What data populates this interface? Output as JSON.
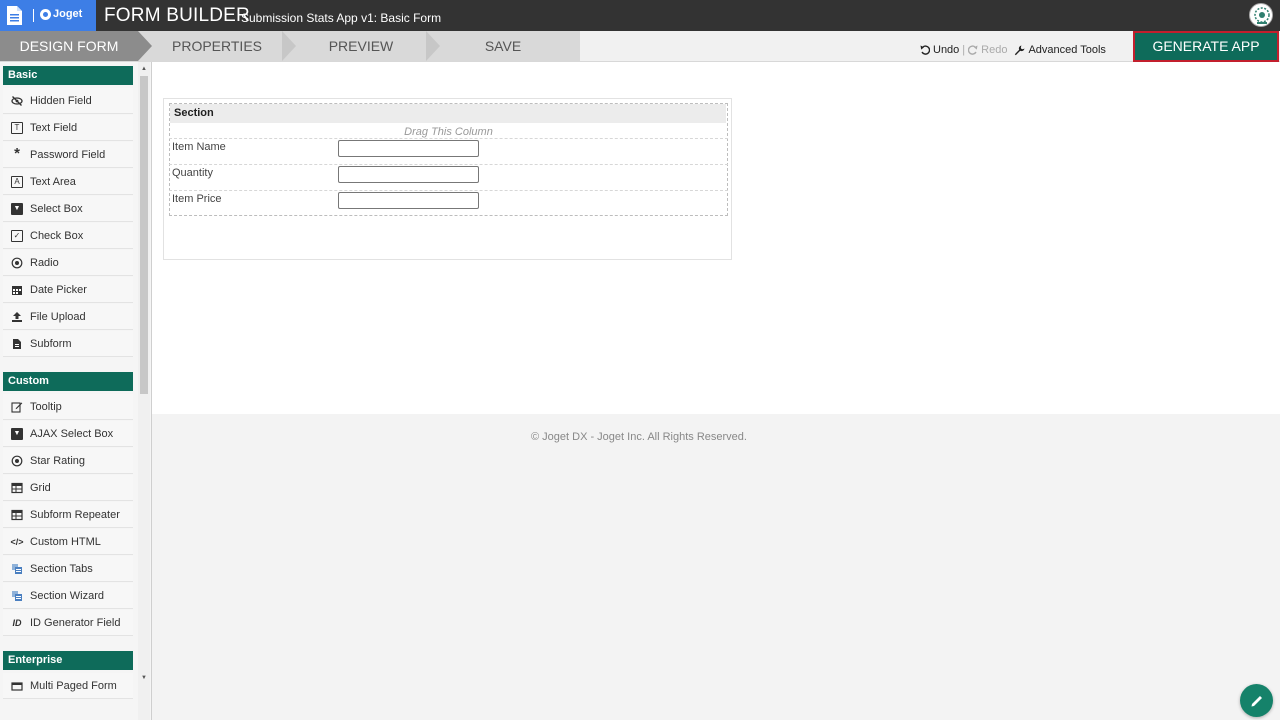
{
  "header": {
    "logo_text": "Joget",
    "title": "FORM BUILDER",
    "subtitle": "Submission Stats App v1: Basic Form"
  },
  "steps": [
    {
      "label": "DESIGN FORM",
      "active": true
    },
    {
      "label": "PROPERTIES",
      "active": false
    },
    {
      "label": "PREVIEW",
      "active": false
    },
    {
      "label": "SAVE",
      "active": false
    }
  ],
  "toolbar": {
    "undo": "Undo",
    "separator": "|",
    "redo": "Redo",
    "advanced_tools": "Advanced Tools",
    "generate_app": "GENERATE APP"
  },
  "palette": {
    "categories": [
      {
        "name": "Basic",
        "items": [
          {
            "label": "Hidden Field",
            "icon": "eye-slash-icon"
          },
          {
            "label": "Text Field",
            "icon": "text-field-icon"
          },
          {
            "label": "Password Field",
            "icon": "asterisk-icon"
          },
          {
            "label": "Text Area",
            "icon": "text-area-icon"
          },
          {
            "label": "Select Box",
            "icon": "caret-box-icon"
          },
          {
            "label": "Check Box",
            "icon": "checkbox-icon"
          },
          {
            "label": "Radio",
            "icon": "radio-icon"
          },
          {
            "label": "Date Picker",
            "icon": "calendar-icon"
          },
          {
            "label": "File Upload",
            "icon": "upload-icon"
          },
          {
            "label": "Subform",
            "icon": "file-icon"
          }
        ]
      },
      {
        "name": "Custom",
        "items": [
          {
            "label": "Tooltip",
            "icon": "edit-icon"
          },
          {
            "label": "AJAX Select Box",
            "icon": "caret-box-icon"
          },
          {
            "label": "Star Rating",
            "icon": "radio-icon"
          },
          {
            "label": "Grid",
            "icon": "table-icon"
          },
          {
            "label": "Subform Repeater",
            "icon": "table-icon"
          },
          {
            "label": "Custom HTML",
            "icon": "code-icon"
          },
          {
            "label": "Section Tabs",
            "icon": "section-icon"
          },
          {
            "label": "Section Wizard",
            "icon": "section-icon"
          },
          {
            "label": "ID Generator Field",
            "icon": "id-icon"
          }
        ]
      },
      {
        "name": "Enterprise",
        "items": [
          {
            "label": "Multi Paged Form",
            "icon": "pages-icon"
          }
        ]
      }
    ]
  },
  "form": {
    "section_title": "Section",
    "drag_column": "Drag This Column",
    "fields": [
      {
        "label": "Item Name",
        "value": ""
      },
      {
        "label": "Quantity",
        "value": ""
      },
      {
        "label": "Item Price",
        "value": ""
      }
    ]
  },
  "footer": {
    "copyright": "© Joget DX - Joget Inc. All Rights Reserved."
  },
  "colors": {
    "brand_green": "#0e6b5a",
    "topbar": "#333333",
    "logo_blue": "#3d7ee6",
    "highlight_red": "#c31f2d"
  }
}
